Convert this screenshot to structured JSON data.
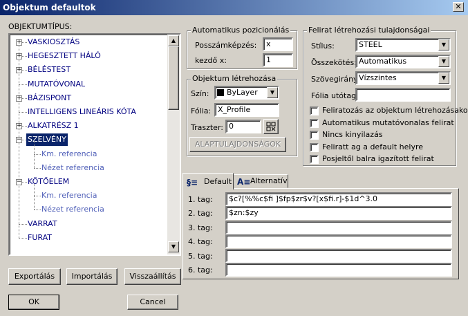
{
  "window": {
    "title": "Objektum defaultok",
    "close_glyph": "✕"
  },
  "tree": {
    "label": "OBJEKTUMTÍPUS:",
    "items": [
      {
        "label": "VASKIOSZTÁS",
        "expander": "+"
      },
      {
        "label": "HEGESZTETT HÁLÓ",
        "expander": "+"
      },
      {
        "label": "BÉLÉSTEST",
        "expander": "+"
      },
      {
        "label": "MUTATÓVONAL",
        "expander": ""
      },
      {
        "label": "BÁZISPONT",
        "expander": "+"
      },
      {
        "label": "INTELLIGENS LINEÁRIS KÓTA",
        "expander": ""
      },
      {
        "label": "ALKATRÉSZ 1",
        "expander": "+"
      },
      {
        "label": "SZELVÉNY",
        "expander": "−",
        "selected": true
      },
      {
        "label": "Km. referencia",
        "child": true
      },
      {
        "label": "Nézet referencia",
        "child": true
      },
      {
        "label": "KÖTŐELEM",
        "expander": "−"
      },
      {
        "label": "Km. referencia",
        "child": true
      },
      {
        "label": "Nézet referencia",
        "child": true
      },
      {
        "label": "VARRAT",
        "expander": ""
      },
      {
        "label": "FURAT",
        "expander": ""
      }
    ]
  },
  "buttons": {
    "export": "Exportálás",
    "import": "Importálás",
    "reset": "Visszaállítás",
    "ok": "OK",
    "cancel": "Cancel",
    "props": "ALAPTULAJDONSÁGOK"
  },
  "auto_pos": {
    "legend": "Automatikus pozicionálás",
    "pos_label": "Posszámképzés:",
    "pos_value": "x",
    "start_label": "kezdő x:",
    "start_value": "1"
  },
  "create": {
    "legend": "Objektum létrehozása",
    "color_label": "Szín:",
    "color_value": "ByLayer",
    "layer_label": "Fólia:",
    "layer_value": "X_Profile",
    "raster_label": "Traszter:",
    "raster_value": "0"
  },
  "label_props": {
    "legend": "Felirat létrehozási tulajdonságai",
    "style_label": "Stílus:",
    "style_value": "STEEL",
    "link_label": "Összekötés:",
    "link_value": "Automatikus",
    "dir_label": "Szövegirány",
    "dir_value": "Vízszintes",
    "suffix_label": "Fólia utótag:",
    "suffix_value": "",
    "checks": [
      "Feliratozás az objektum létrehozásakor",
      "Automatikus mutatóvonalas felirat",
      "Nincs kinyilazás",
      "Feliratt ag a default helyre",
      "Posjeltől balra igazított felirat"
    ]
  },
  "tabs": [
    {
      "label": "Default",
      "active": true
    },
    {
      "label": "Alternatív",
      "active": false
    }
  ],
  "tags": [
    {
      "label": "1. tag:",
      "value": "$c?[%%c$fi ]$fp$zr$v?[x$fi.r]-$1d^3.0"
    },
    {
      "label": "2. tag:",
      "value": "$zn:$zy"
    },
    {
      "label": "3. tag:",
      "value": ""
    },
    {
      "label": "4. tag:",
      "value": ""
    },
    {
      "label": "5. tag:",
      "value": ""
    },
    {
      "label": "6. tag:",
      "value": ""
    }
  ]
}
